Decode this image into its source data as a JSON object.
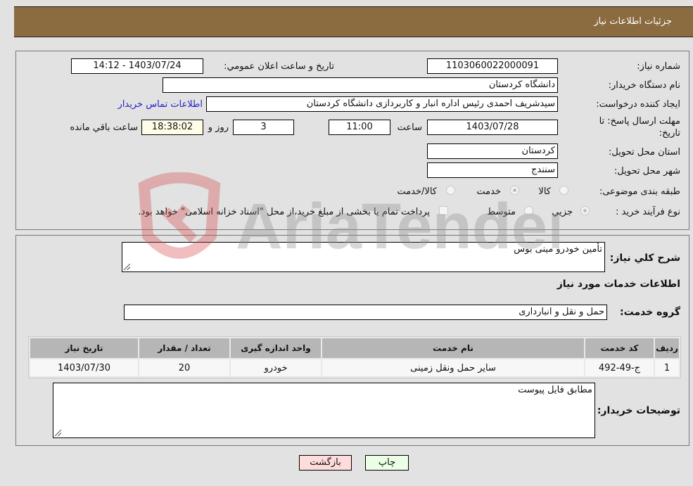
{
  "header": {
    "title": "جزئیات اطلاعات نیاز"
  },
  "fields": {
    "need_number_label": "شماره نیاز:",
    "need_number": "1103060022000091",
    "announce_label": "تاریخ و ساعت اعلان عمومي:",
    "announce_value": "1403/07/24 - 14:12",
    "buyer_org_label": "نام دستگاه خريدار:",
    "buyer_org": "دانشگاه كردستان",
    "creator_label": "ايجاد كننده درخواست:",
    "creator": "سیدشریف احمدی رئیس اداره انبار و کاربردازی دانشگاه کردستان",
    "contact_link": "اطلاعات تماس خريدار",
    "deadline_label_1": "مهلت ارسال پاسخ: تا",
    "deadline_label_2": "تاريخ:",
    "deadline_date": "1403/07/28",
    "time_label": "ساعت",
    "deadline_time": "11:00",
    "days_value": "3",
    "days_label": "روز و",
    "remaining_time": "18:38:02",
    "remaining_label": "ساعت باقي مانده",
    "province_label": "استان محل تحويل:",
    "province": "كردستان",
    "city_label": "شهر محل تحويل:",
    "city": "سنندج",
    "category_label": "طبقه بندی موضوعی:",
    "category_options": [
      {
        "label": "كالا",
        "checked": false
      },
      {
        "label": "خدمت",
        "checked": true
      },
      {
        "label": "كالا/خدمت",
        "checked": false
      }
    ],
    "process_label": "نوع فرآیند خرید :",
    "process_options": [
      {
        "label": "جزيي",
        "checked": true
      },
      {
        "label": "متوسط",
        "checked": false
      }
    ],
    "treasury_note": "پرداخت تمام یا بخشی از مبلغ خرید،از محل \"اسناد خزانه اسلامی\" خواهد بود."
  },
  "details": {
    "summary_label": "شرح كلي نياز:",
    "summary": "تأمین خودرو مینی بوس",
    "services_heading": "اطلاعات خدمات مورد نياز",
    "service_group_label": "گروه خدمت:",
    "service_group": "حمل و نقل و انبارداری",
    "table": {
      "headers": [
        "رديف",
        "كد خدمت",
        "نام خدمت",
        "واحد اندازه گيری",
        "تعداد / مقدار",
        "تاريخ نياز"
      ],
      "rows": [
        [
          "1",
          "ج-49-492",
          "سایر حمل ونقل زمینی",
          "خودرو",
          "20",
          "1403/07/30"
        ]
      ]
    },
    "buyer_notes_label": "توضيحات خريدار:",
    "buyer_notes": "مطابق فایل پیوست"
  },
  "buttons": {
    "print": "چاپ",
    "back": "بازگشت"
  },
  "watermark": {
    "text": "AriaTender.neT"
  }
}
